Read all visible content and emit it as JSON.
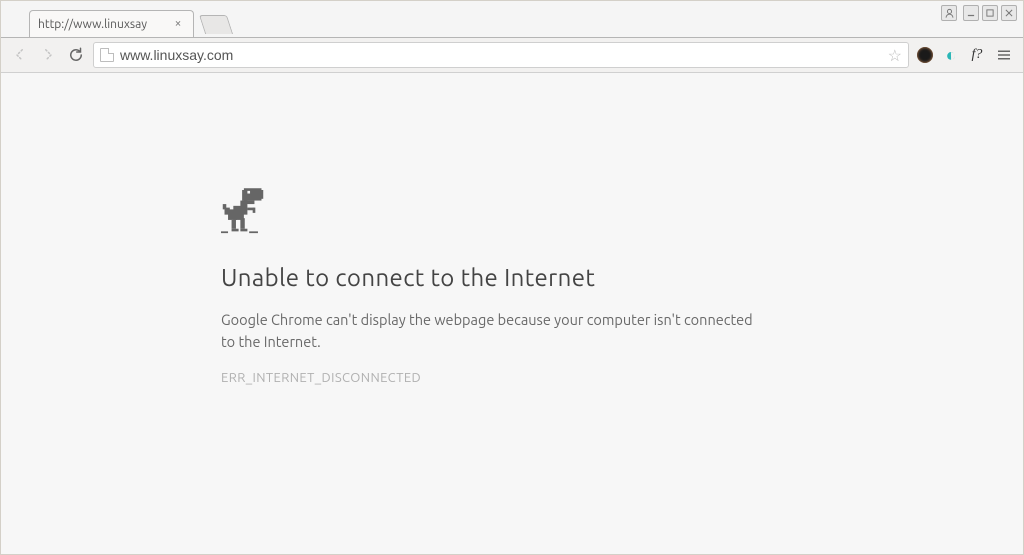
{
  "tab": {
    "title": "http://www.linuxsay"
  },
  "omnibox": {
    "url": "www.linuxsay.com"
  },
  "error": {
    "heading": "Unable to connect to the Internet",
    "description": "Google Chrome can't display the webpage because your computer isn't connected to the Internet.",
    "code": "ERR_INTERNET_DISCONNECTED"
  }
}
